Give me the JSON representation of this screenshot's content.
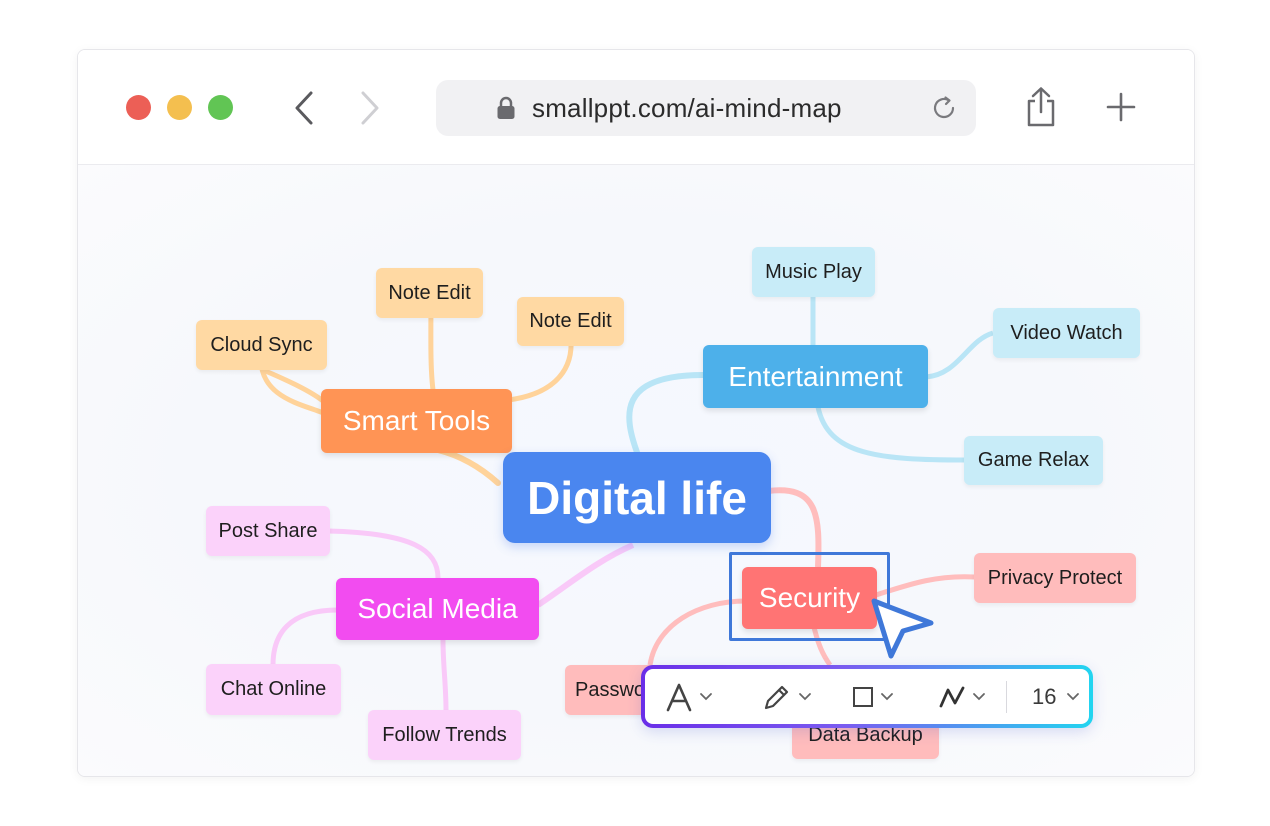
{
  "browser": {
    "url": "smallppt.com/ai-mind-map",
    "traffic_lights": {
      "close": "#ec5f56",
      "minimize": "#f4bf4f",
      "maximize": "#61c554"
    }
  },
  "mind_map": {
    "root": {
      "label": "Digital life",
      "color": "#4a86ef"
    },
    "branches": [
      {
        "id": "smart",
        "label": "Smart Tools",
        "color": "#ff9455",
        "leaf_color": "#ffd9a3",
        "link_color": "#ffd39a",
        "children": [
          "Cloud Sync",
          "Note Edit",
          "Note Edit"
        ]
      },
      {
        "id": "ent",
        "label": "Entertainment",
        "color": "#4db0ea",
        "leaf_color": "#c8ecf8",
        "link_color": "#b9e5f6",
        "children": [
          "Music Play",
          "Video Watch",
          "Game Relax"
        ]
      },
      {
        "id": "social",
        "label": "Social Media",
        "color": "#f24cf0",
        "leaf_color": "#fbd2fa",
        "link_color": "#f9c9f8",
        "children": [
          "Post Share",
          "Chat Online",
          "Follow Trends"
        ]
      },
      {
        "id": "sec",
        "label": "Security",
        "color": "#ff7474",
        "leaf_color": "#ffbcbc",
        "link_color": "#ffbdbd",
        "children": [
          "Privacy Protect",
          "Password",
          "Data Backup"
        ]
      }
    ]
  },
  "toolbar": {
    "items": [
      {
        "icon": "text-style-icon"
      },
      {
        "icon": "pen-icon"
      },
      {
        "icon": "shape-icon"
      },
      {
        "icon": "line-style-icon"
      }
    ],
    "font_size": "16"
  },
  "selection": {
    "node": "Security",
    "color": "#3f78d9"
  }
}
